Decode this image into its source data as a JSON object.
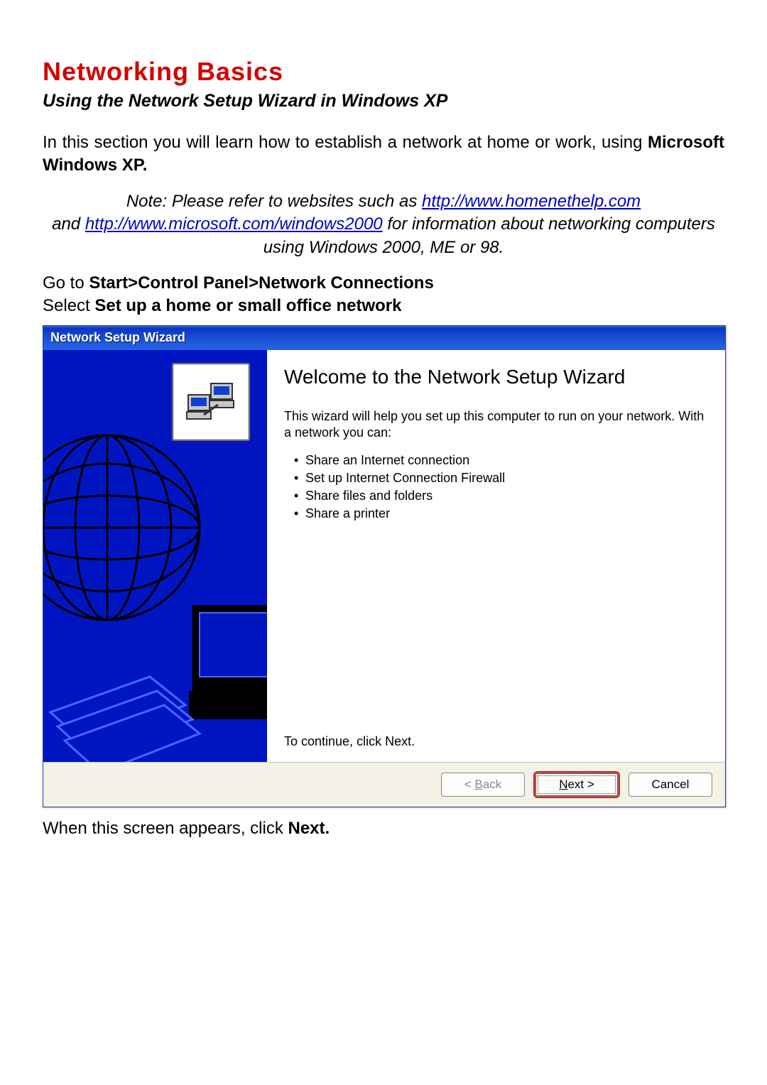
{
  "doc": {
    "title": "Networking Basics",
    "subtitle": "Using the Network Setup Wizard in Windows XP",
    "intro_a": "In this section you will learn how to establish a network at home or work, using ",
    "intro_bold": "Microsoft Windows XP.",
    "note_prefix": "Note:  Please refer to websites such as ",
    "note_link1": "http://www.homenethelp.com",
    "note_mid1": " and ",
    "note_link2": "http://www.microsoft.com/windows2000",
    "note_tail": "  for information about networking computers using Windows 2000, ME or 98.",
    "instr1_a": "Go to ",
    "instr1_b": "Start>Control Panel>Network Connections",
    "instr2_a": "Select ",
    "instr2_b": "Set up a home or small office network",
    "after_a": "When this screen appears, click ",
    "after_b": "Next."
  },
  "wizard": {
    "title": "Network Setup Wizard",
    "heading": "Welcome to the Network Setup Wizard",
    "para": "This wizard will help you set up this computer to run on your network. With a network you can:",
    "bullets": [
      "Share an Internet connection",
      "Set up Internet Connection Firewall",
      "Share files and folders",
      "Share a printer"
    ],
    "continue_text": "To continue, click Next.",
    "buttons": {
      "back_prefix": "< ",
      "back_mnemonic": "B",
      "back_suffix": "ack",
      "next_mnemonic": "N",
      "next_suffix": "ext >",
      "cancel": "Cancel"
    }
  }
}
